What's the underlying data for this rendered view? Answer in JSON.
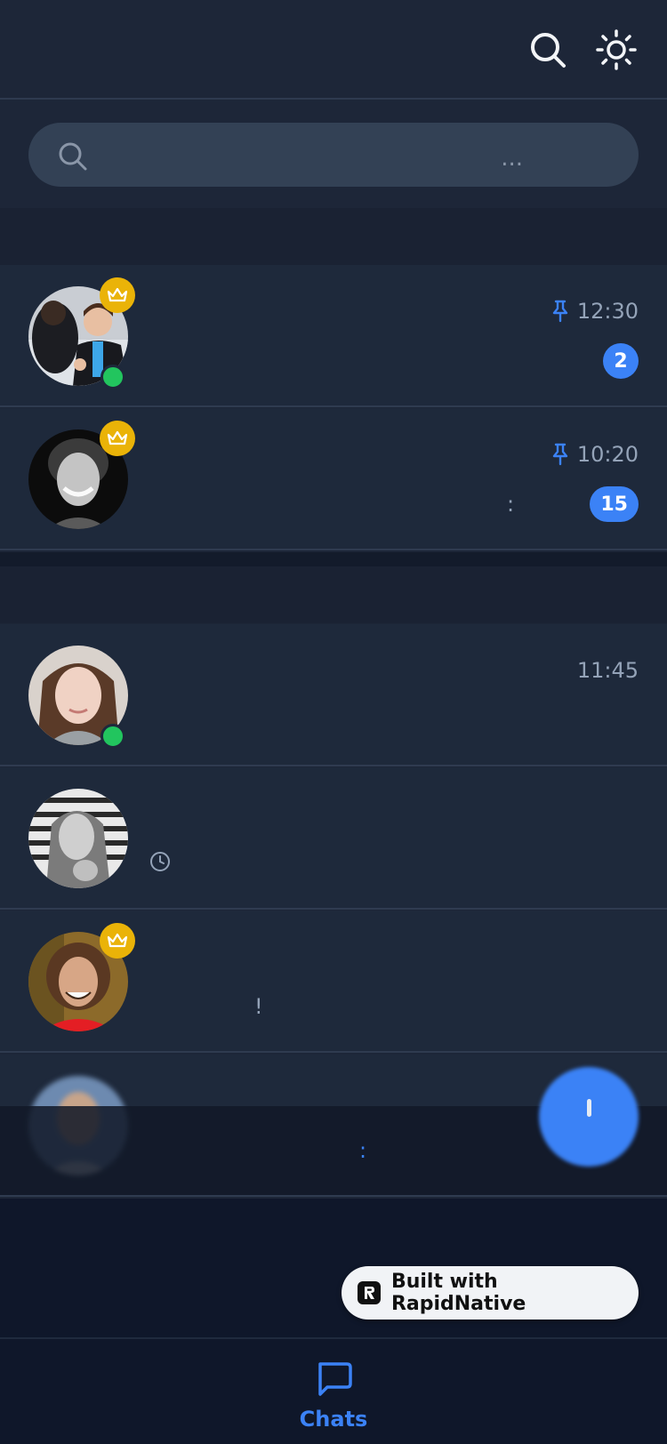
{
  "search": {
    "placeholder": "..."
  },
  "chats": [
    {
      "time": "12:30",
      "pinned": true,
      "unread": "2",
      "preview": "",
      "premium": true,
      "online": true
    },
    {
      "time": "10:20",
      "pinned": true,
      "unread": "15",
      "preview": ":",
      "premium": true,
      "online": false
    },
    {
      "time": "11:45",
      "pinned": false,
      "unread": "",
      "preview": "",
      "premium": false,
      "online": true
    },
    {
      "time": "",
      "pinned": false,
      "unread": "",
      "preview": "",
      "premium": false,
      "online": false,
      "scheduled": true
    },
    {
      "time": "",
      "pinned": false,
      "unread": "",
      "preview": "!",
      "premium": true,
      "online": false
    },
    {
      "time": "",
      "pinned": false,
      "unread": "",
      "preview": ":",
      "premium": false,
      "online": false
    }
  ],
  "branding": {
    "built_with": "Built with RapidNative"
  },
  "tabbar": {
    "chats_label": "Chats"
  },
  "colors": {
    "accent": "#3b82f6",
    "online": "#22c55e",
    "premium": "#eab308",
    "background": "#1e293b"
  },
  "icons": [
    "search-icon",
    "sun-icon",
    "pin-icon",
    "crown-icon",
    "clock-icon",
    "chat-bubble-icon",
    "plus-icon"
  ]
}
